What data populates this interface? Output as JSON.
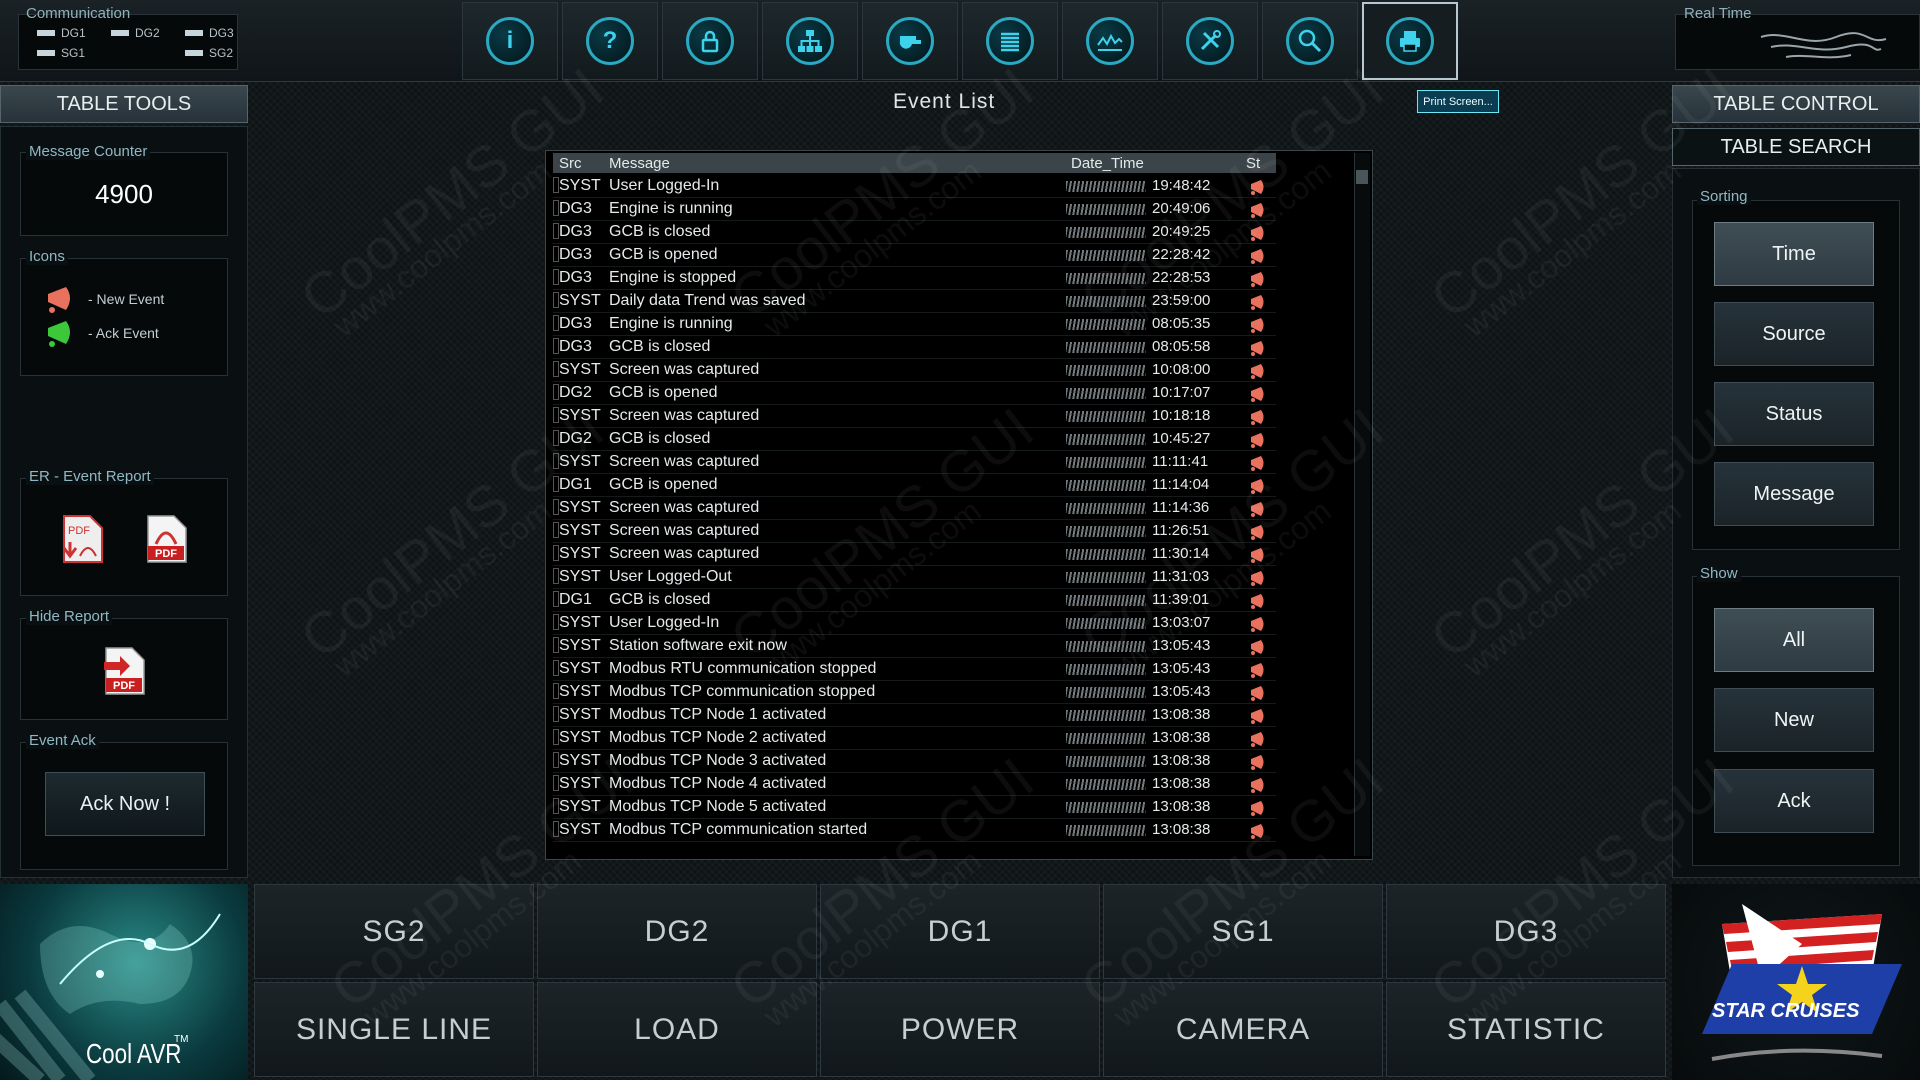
{
  "top": {
    "communication_title": "Communication",
    "comm_items": [
      "DG1",
      "DG2",
      "DG3",
      "SG1",
      "SG2"
    ],
    "realtime_title": "Real Time",
    "toolbar_icons": [
      "info-icon",
      "help-icon",
      "lock-icon",
      "network-icon",
      "whistle-icon",
      "list-icon",
      "trend-icon",
      "tools-icon",
      "search-icon",
      "printer-icon"
    ],
    "print_tooltip": "Print Screen..."
  },
  "left": {
    "header": "TABLE TOOLS",
    "counter_label": "Message Counter",
    "counter_value": "4900",
    "icons_label": "Icons",
    "new_event_label": "- New Event",
    "ack_event_label": "- Ack Event",
    "er_label": "ER - Event Report",
    "hide_label": "Hide Report",
    "event_ack_label": "Event Ack",
    "ack_now_label": "Ack Now !"
  },
  "center": {
    "title": "Event List",
    "columns": [
      "Src",
      "Message",
      "Date_Time",
      "St"
    ],
    "rows": [
      {
        "src": "SYST",
        "msg": "User Logged-In",
        "time": "19:48:42"
      },
      {
        "src": "DG3",
        "msg": "Engine is running",
        "time": "20:49:06"
      },
      {
        "src": "DG3",
        "msg": "GCB is closed",
        "time": "20:49:25"
      },
      {
        "src": "DG3",
        "msg": "GCB is opened",
        "time": "22:28:42"
      },
      {
        "src": "DG3",
        "msg": "Engine is stopped",
        "time": "22:28:53"
      },
      {
        "src": "SYST",
        "msg": "Daily data Trend was saved",
        "time": "23:59:00"
      },
      {
        "src": "DG3",
        "msg": "Engine is running",
        "time": "08:05:35"
      },
      {
        "src": "DG3",
        "msg": "GCB is closed",
        "time": "08:05:58"
      },
      {
        "src": "SYST",
        "msg": "Screen was captured",
        "time": "10:08:00"
      },
      {
        "src": "DG2",
        "msg": "GCB is opened",
        "time": "10:17:07"
      },
      {
        "src": "SYST",
        "msg": "Screen was captured",
        "time": "10:18:18"
      },
      {
        "src": "DG2",
        "msg": "GCB is closed",
        "time": "10:45:27"
      },
      {
        "src": "SYST",
        "msg": "Screen was captured",
        "time": "11:11:41"
      },
      {
        "src": "DG1",
        "msg": "GCB is opened",
        "time": "11:14:04"
      },
      {
        "src": "SYST",
        "msg": "Screen was captured",
        "time": "11:14:36"
      },
      {
        "src": "SYST",
        "msg": "Screen was captured",
        "time": "11:26:51"
      },
      {
        "src": "SYST",
        "msg": "Screen was captured",
        "time": "11:30:14"
      },
      {
        "src": "SYST",
        "msg": "User Logged-Out",
        "time": "11:31:03"
      },
      {
        "src": "DG1",
        "msg": "GCB is closed",
        "time": "11:39:01"
      },
      {
        "src": "SYST",
        "msg": "User Logged-In",
        "time": "13:03:07"
      },
      {
        "src": "SYST",
        "msg": "Station software exit now",
        "time": "13:05:43"
      },
      {
        "src": "SYST",
        "msg": "Modbus RTU communication stopped",
        "time": "13:05:43"
      },
      {
        "src": "SYST",
        "msg": "Modbus TCP communication stopped",
        "time": "13:05:43"
      },
      {
        "src": "SYST",
        "msg": "Modbus TCP Node 1 activated",
        "time": "13:08:38"
      },
      {
        "src": "SYST",
        "msg": "Modbus TCP Node 2 activated",
        "time": "13:08:38"
      },
      {
        "src": "SYST",
        "msg": "Modbus TCP Node 3 activated",
        "time": "13:08:38"
      },
      {
        "src": "SYST",
        "msg": "Modbus TCP Node 4 activated",
        "time": "13:08:38"
      },
      {
        "src": "SYST",
        "msg": "Modbus TCP Node 5 activated",
        "time": "13:08:38"
      },
      {
        "src": "SYST",
        "msg": "Modbus TCP communication started",
        "time": "13:08:38"
      }
    ]
  },
  "right": {
    "header": "TABLE CONTROL",
    "search_label": "TABLE SEARCH",
    "sorting_label": "Sorting",
    "sorting_options": [
      "Time",
      "Source",
      "Status",
      "Message"
    ],
    "show_label": "Show",
    "show_options": [
      "All",
      "New",
      "Ack"
    ]
  },
  "bottom": {
    "nav_row1": [
      "SG2",
      "DG2",
      "DG1",
      "SG1",
      "DG3"
    ],
    "nav_row2": [
      "SINGLE LINE",
      "LOAD",
      "POWER",
      "CAMERA",
      "STATISTIC"
    ],
    "coolavr_text": "Cool AVR",
    "coolavr_tm": "TM",
    "brand_text": "STAR CRUISES"
  },
  "watermark": {
    "text1": "CoolPMS GUI",
    "text2": "www.coolpms.com"
  },
  "colors": {
    "accent": "#2aa9c2",
    "new_event": "#e8725e",
    "ack_event": "#3cc83a"
  }
}
